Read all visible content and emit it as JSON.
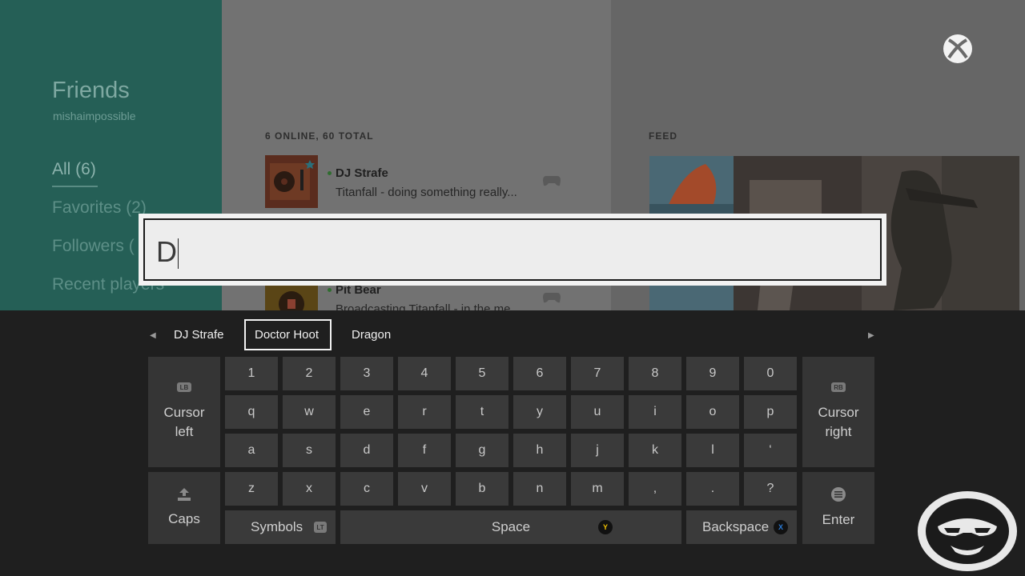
{
  "sidebar": {
    "title": "Friends",
    "username": "mishaimpossible",
    "filters": [
      "All (6)",
      "Favorites (2)",
      "Followers (",
      "Recent players"
    ]
  },
  "friends": {
    "header": "6 ONLINE, 60 TOTAL",
    "list": [
      {
        "name": "DJ Strafe",
        "status": "Titanfall - doing something really..."
      },
      {
        "name": "Pit Bear",
        "status": "Broadcasting Titanfall - in the me"
      }
    ]
  },
  "feed": {
    "header": "FEED"
  },
  "input": {
    "value": "D"
  },
  "suggestions": [
    "DJ Strafe",
    "Doctor Hoot",
    "Dragon"
  ],
  "keyboard": {
    "row1": [
      "1",
      "2",
      "3",
      "4",
      "5",
      "6",
      "7",
      "8",
      "9",
      "0"
    ],
    "row2": [
      "q",
      "w",
      "e",
      "r",
      "t",
      "y",
      "u",
      "i",
      "o",
      "p"
    ],
    "row3": [
      "a",
      "s",
      "d",
      "f",
      "g",
      "h",
      "j",
      "k",
      "l",
      "‘"
    ],
    "row4": [
      "z",
      "x",
      "c",
      "v",
      "b",
      "n",
      "m",
      ",",
      ".",
      "?"
    ],
    "cursor_left": {
      "badge": "LB",
      "line1": "Cursor",
      "line2": "left"
    },
    "cursor_right": {
      "badge": "RB",
      "line1": "Cursor",
      "line2": "right"
    },
    "caps": "Caps",
    "symbols": "Symbols",
    "symbols_badge": "LT",
    "space": "Space",
    "space_button": "Y",
    "backspace": "Backspace",
    "backspace_button": "X",
    "enter": "Enter"
  },
  "colors": {
    "sidebar": "#255f56",
    "y_button": "#f0c000",
    "x_button": "#2b7bd6"
  }
}
